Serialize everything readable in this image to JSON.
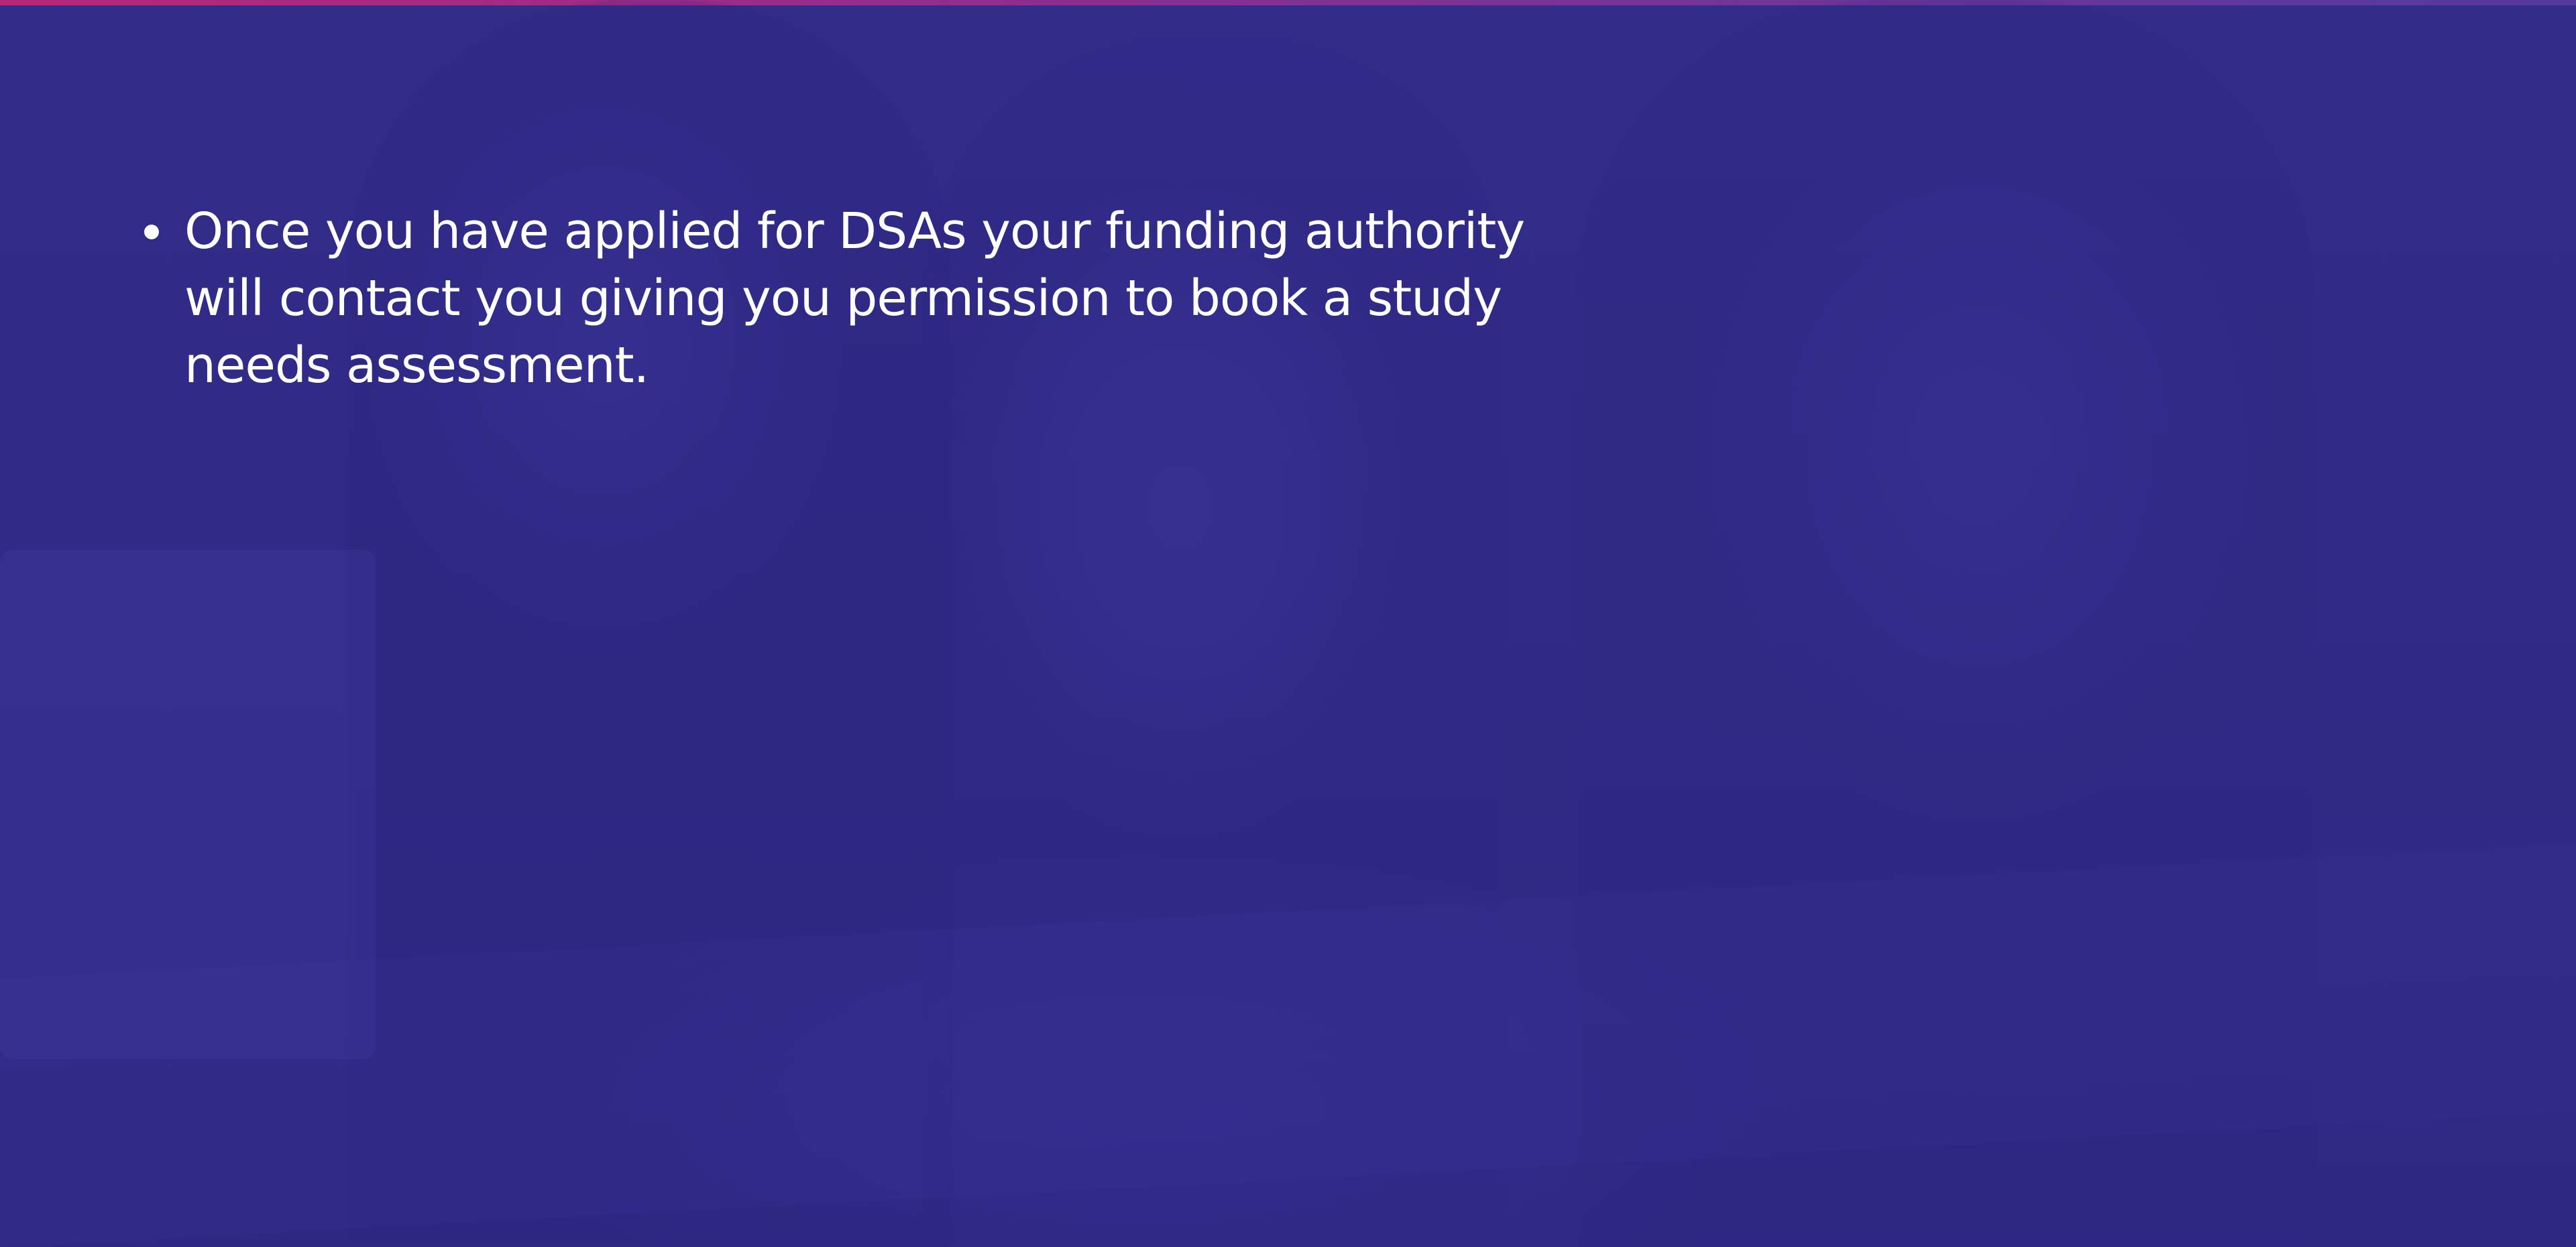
{
  "slide": {
    "bullets": [
      {
        "text": "Once you have applied for DSAs your funding authority will contact you giving you permission to book a study needs assessment."
      }
    ]
  },
  "colors": {
    "background": "#2f2a84",
    "text": "#ffffff",
    "accent_start": "#d6246e",
    "accent_end": "#5a3aa0"
  }
}
